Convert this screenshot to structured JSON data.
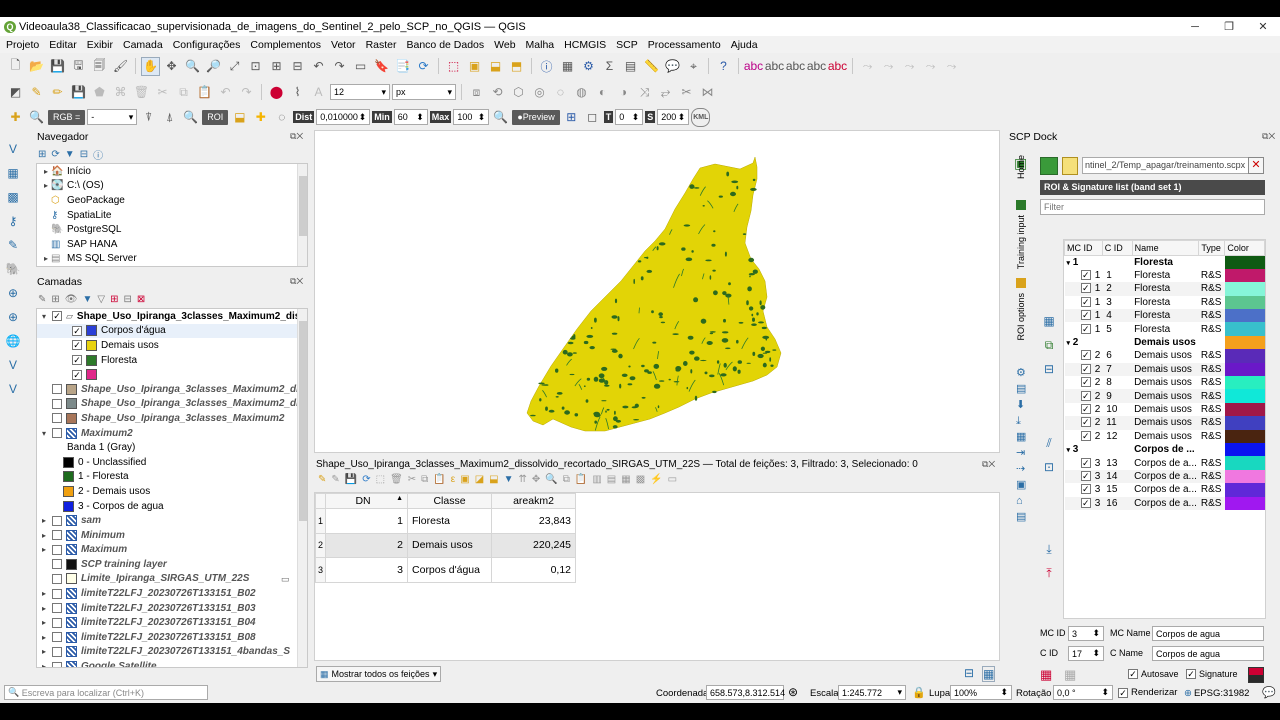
{
  "window": {
    "title": "Videoaula38_Classificacao_supervisionada_de_imagens_do_Sentinel_2_pelo_SCP_no_QGIS — QGIS"
  },
  "menu": [
    "Projeto",
    "Editar",
    "Exibir",
    "Camada",
    "Configurações",
    "Complementos",
    "Vetor",
    "Raster",
    "Banco de Dados",
    "Web",
    "Malha",
    "HCMGIS",
    "SCP",
    "Processamento",
    "Ajuda"
  ],
  "toolbar2": {
    "font_size": "12",
    "unit": "px"
  },
  "scp_toolbar": {
    "rgb_label": "RGB =",
    "rgb_value": "-",
    "roi_label": "ROI",
    "dist_label": "Dist",
    "dist_value": "0,010000",
    "min_label": "Min",
    "min_value": "60",
    "max_label": "Max",
    "max_value": "100",
    "preview_label": "Preview",
    "t_label": "T",
    "t_value": "0",
    "s_label": "S",
    "s_value": "200",
    "kml_label": "KML"
  },
  "navigator": {
    "title": "Navegador",
    "items": [
      {
        "label": "Início",
        "expandable": true
      },
      {
        "label": "C:\\ (OS)",
        "expandable": true
      },
      {
        "label": "GeoPackage",
        "expandable": false
      },
      {
        "label": "SpatiaLite",
        "expandable": false
      },
      {
        "label": "PostgreSQL",
        "expandable": false
      },
      {
        "label": "SAP HANA",
        "expandable": false
      },
      {
        "label": "MS SQL Server",
        "expandable": true
      }
    ]
  },
  "layers": {
    "title": "Camadas",
    "items": [
      {
        "label": "Shape_Uso_Ipiranga_3classes_Maximum2_dis",
        "indent": 0,
        "checked": true,
        "bold": true,
        "italic": false,
        "expand": "v",
        "swatch": null
      },
      {
        "label": "Corpos d'água",
        "indent": 2,
        "checked": true,
        "bold": false,
        "italic": false,
        "expand": "",
        "swatch": "#2a3fd6"
      },
      {
        "label": "Demais usos",
        "indent": 2,
        "checked": true,
        "bold": false,
        "italic": false,
        "expand": "",
        "swatch": "#e8d20e"
      },
      {
        "label": "Floresta",
        "indent": 2,
        "checked": true,
        "bold": false,
        "italic": false,
        "expand": "",
        "swatch": "#2d7a2a"
      },
      {
        "label": "",
        "indent": 2,
        "checked": true,
        "bold": false,
        "italic": false,
        "expand": "",
        "swatch": "#e0288a"
      },
      {
        "label": "Shape_Uso_Ipiranga_3classes_Maximum2_di",
        "indent": 0,
        "checked": false,
        "bold": true,
        "italic": true,
        "expand": "",
        "swatch": "#b8a488"
      },
      {
        "label": "Shape_Uso_Ipiranga_3classes_Maximum2_di",
        "indent": 0,
        "checked": false,
        "bold": true,
        "italic": true,
        "expand": "",
        "swatch": "#7c8a8a"
      },
      {
        "label": "Shape_Uso_Ipiranga_3classes_Maximum2",
        "indent": 0,
        "checked": false,
        "bold": true,
        "italic": true,
        "expand": "",
        "swatch": "#a8765a"
      },
      {
        "label": "Maximum2",
        "indent": 0,
        "checked": false,
        "bold": true,
        "italic": true,
        "expand": "v",
        "swatch": "raster"
      },
      {
        "label": "Banda 1 (Gray)",
        "indent": 1,
        "checked": null,
        "bold": false,
        "italic": false,
        "expand": "",
        "swatch": null
      },
      {
        "label": "0 - Unclassified",
        "indent": 1,
        "checked": null,
        "bold": false,
        "italic": false,
        "expand": "",
        "swatch": "#000000"
      },
      {
        "label": "1 - Floresta",
        "indent": 1,
        "checked": null,
        "bold": false,
        "italic": false,
        "expand": "",
        "swatch": "#1e6b1e"
      },
      {
        "label": "2 - Demais usos",
        "indent": 1,
        "checked": null,
        "bold": false,
        "italic": false,
        "expand": "",
        "swatch": "#f0a010"
      },
      {
        "label": "3 - Corpos de agua",
        "indent": 1,
        "checked": null,
        "bold": false,
        "italic": false,
        "expand": "",
        "swatch": "#1020e0"
      },
      {
        "label": "sam",
        "indent": 0,
        "checked": false,
        "bold": true,
        "italic": true,
        "expand": ">",
        "swatch": "raster"
      },
      {
        "label": "Minimum",
        "indent": 0,
        "checked": false,
        "bold": true,
        "italic": true,
        "expand": ">",
        "swatch": "raster"
      },
      {
        "label": "Maximum",
        "indent": 0,
        "checked": false,
        "bold": true,
        "italic": true,
        "expand": ">",
        "swatch": "raster"
      },
      {
        "label": "SCP training layer",
        "indent": 0,
        "checked": false,
        "bold": true,
        "italic": true,
        "expand": "",
        "swatch": "#111111"
      },
      {
        "label": "Limite_Ipiranga_SIRGAS_UTM_22S",
        "indent": 0,
        "checked": false,
        "bold": true,
        "italic": true,
        "expand": "",
        "swatch": "#ffffe8"
      },
      {
        "label": "limiteT22LFJ_20230726T133151_B02",
        "indent": 0,
        "checked": false,
        "bold": true,
        "italic": true,
        "expand": ">",
        "swatch": "raster"
      },
      {
        "label": "limiteT22LFJ_20230726T133151_B03",
        "indent": 0,
        "checked": false,
        "bold": true,
        "italic": true,
        "expand": ">",
        "swatch": "raster"
      },
      {
        "label": "limiteT22LFJ_20230726T133151_B04",
        "indent": 0,
        "checked": false,
        "bold": true,
        "italic": true,
        "expand": ">",
        "swatch": "raster"
      },
      {
        "label": "limiteT22LFJ_20230726T133151_B08",
        "indent": 0,
        "checked": false,
        "bold": true,
        "italic": true,
        "expand": ">",
        "swatch": "raster"
      },
      {
        "label": "limiteT22LFJ_20230726T133151_4bandas_S",
        "indent": 0,
        "checked": false,
        "bold": true,
        "italic": true,
        "expand": ">",
        "swatch": "raster"
      },
      {
        "label": "Google Satellite",
        "indent": 0,
        "checked": false,
        "bold": true,
        "italic": true,
        "expand": ">",
        "swatch": "raster"
      }
    ]
  },
  "attribute_table": {
    "title": "Shape_Uso_Ipiranga_3classes_Maximum2_dissolvido_recortado_SIRGAS_UTM_22S — Total de feições: 3, Filtrado: 3, Selecionado: 0",
    "columns": [
      "DN",
      "Classe",
      "areakm2"
    ],
    "rows": [
      [
        "1",
        "1",
        "Floresta",
        "23,843"
      ],
      [
        "2",
        "2",
        "Demais usos",
        "220,245"
      ],
      [
        "3",
        "3",
        "Corpos d'água",
        "0,12"
      ]
    ],
    "show_all": "Mostrar todos os feições"
  },
  "scp_dock": {
    "title": "SCP Dock",
    "path": "ntinel_2/Temp_apagar/treinamento.scpx",
    "tabs": [
      "Home",
      "Training input",
      "ROI options"
    ],
    "roi_header": "ROI & Signature list (band set 1)",
    "filter_placeholder": "Filter",
    "columns": [
      "MC ID",
      "C ID",
      "Name",
      "Type",
      "Color"
    ],
    "rows": [
      {
        "mc": "1",
        "cid": "",
        "name": "Floresta",
        "type": "",
        "color": "#0f5a12",
        "group": true
      },
      {
        "mc": "1",
        "cid": "1",
        "name": "Floresta",
        "type": "R&S",
        "color": "#c0196a",
        "group": false
      },
      {
        "mc": "1",
        "cid": "2",
        "name": "Floresta",
        "type": "R&S",
        "color": "#86f5d8",
        "group": false
      },
      {
        "mc": "1",
        "cid": "3",
        "name": "Floresta",
        "type": "R&S",
        "color": "#5cc690",
        "group": false
      },
      {
        "mc": "1",
        "cid": "4",
        "name": "Floresta",
        "type": "R&S",
        "color": "#4c70c8",
        "group": false
      },
      {
        "mc": "1",
        "cid": "5",
        "name": "Floresta",
        "type": "R&S",
        "color": "#38c0cc",
        "group": false
      },
      {
        "mc": "2",
        "cid": "",
        "name": "Demais usos",
        "type": "",
        "color": "#f4a01c",
        "group": true
      },
      {
        "mc": "2",
        "cid": "6",
        "name": "Demais usos",
        "type": "R&S",
        "color": "#5a2ab8",
        "group": false
      },
      {
        "mc": "2",
        "cid": "7",
        "name": "Demais usos",
        "type": "R&S",
        "color": "#6a18c8",
        "group": false
      },
      {
        "mc": "2",
        "cid": "8",
        "name": "Demais usos",
        "type": "R&S",
        "color": "#28eec0",
        "group": false
      },
      {
        "mc": "2",
        "cid": "9",
        "name": "Demais usos",
        "type": "R&S",
        "color": "#10e8d8",
        "group": false
      },
      {
        "mc": "2",
        "cid": "10",
        "name": "Demais usos",
        "type": "R&S",
        "color": "#a01848",
        "group": false
      },
      {
        "mc": "2",
        "cid": "11",
        "name": "Demais usos",
        "type": "R&S",
        "color": "#4040c0",
        "group": false
      },
      {
        "mc": "2",
        "cid": "12",
        "name": "Demais usos",
        "type": "R&S",
        "color": "#4a2410",
        "group": false
      },
      {
        "mc": "3",
        "cid": "",
        "name": "Corpos de ...",
        "type": "",
        "color": "#0a14f0",
        "group": true
      },
      {
        "mc": "3",
        "cid": "13",
        "name": "Corpos de a...",
        "type": "R&S",
        "color": "#18d8c0",
        "group": false
      },
      {
        "mc": "3",
        "cid": "14",
        "name": "Corpos de a...",
        "type": "R&S",
        "color": "#f078e0",
        "group": false
      },
      {
        "mc": "3",
        "cid": "15",
        "name": "Corpos de a...",
        "type": "R&S",
        "color": "#6028d8",
        "group": false
      },
      {
        "mc": "3",
        "cid": "16",
        "name": "Corpos de a...",
        "type": "R&S",
        "color": "#a018f0",
        "group": false
      }
    ],
    "mc_id_label": "MC ID",
    "mc_id": "3",
    "mc_name_label": "MC Name",
    "mc_name": "Corpos de agua",
    "c_id_label": "C ID",
    "c_id": "17",
    "c_name_label": "C Name",
    "c_name": "Corpos de agua",
    "autosave": "Autosave",
    "signature": "Signature"
  },
  "statusbar": {
    "search_placeholder": "Escreva para localizar (Ctrl+K)",
    "coord_label": "Coordenada",
    "coord": "658.573,8.312.514",
    "scale_label": "Escala",
    "scale": "1:245.772",
    "zoom_label": "Lupa",
    "zoom": "100%",
    "rotation_label": "Rotação",
    "rotation": "0,0 °",
    "render_label": "Renderizar",
    "crs": "EPSG:31982"
  },
  "colors": {
    "map_yellow": "#e2d406",
    "map_green": "#2c6a1e",
    "cursor_highlight": "#fff25a"
  }
}
